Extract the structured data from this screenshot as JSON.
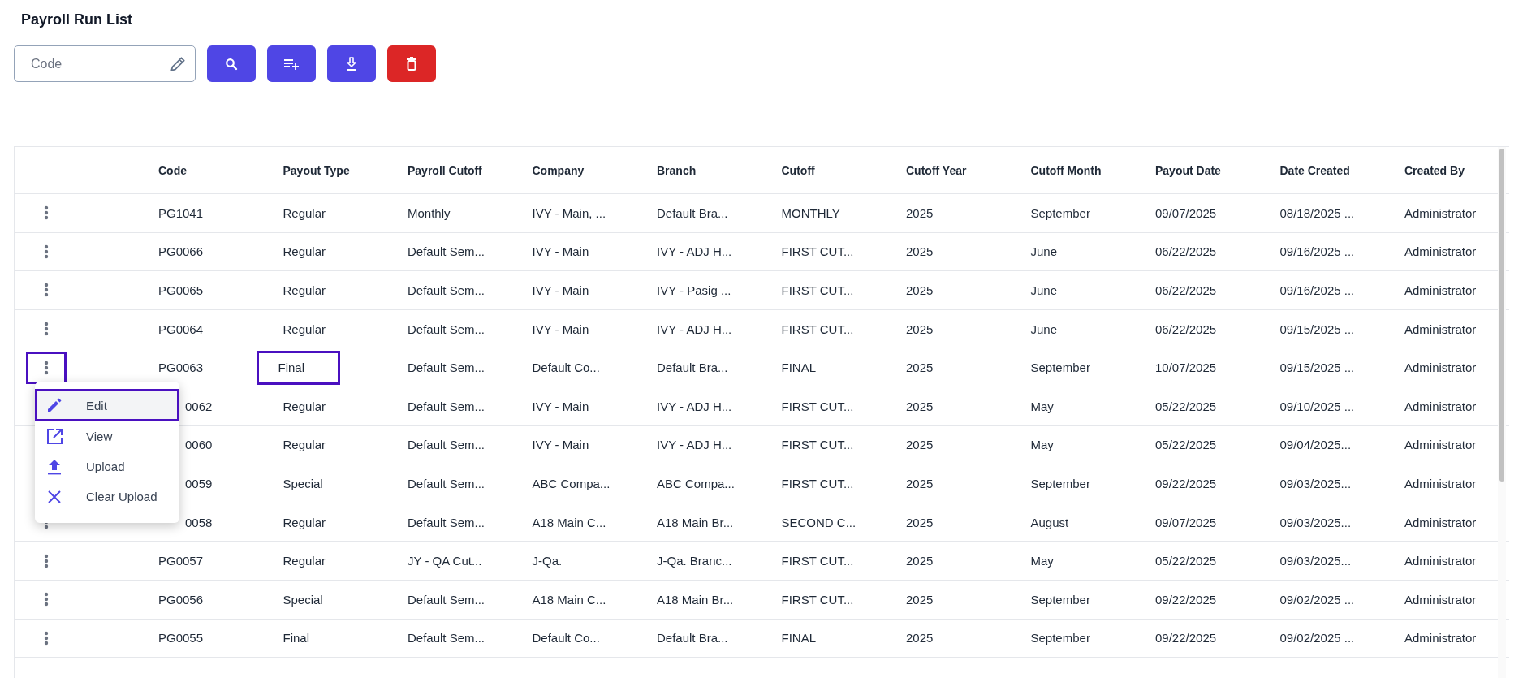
{
  "title": "Payroll Run List",
  "search": {
    "placeholder": "Code"
  },
  "toolbar_buttons": [
    {
      "kind": "search",
      "color": "#4f46e5"
    },
    {
      "kind": "add-list",
      "color": "#4f46e5"
    },
    {
      "kind": "download",
      "color": "#4f46e5"
    },
    {
      "kind": "delete",
      "color": "#dc2626"
    }
  ],
  "table": {
    "columns": [
      "Code",
      "Payout Type",
      "Payroll Cutoff",
      "Company",
      "Branch",
      "Cutoff",
      "Cutoff Year",
      "Cutoff Month",
      "Payout Date",
      "Date Created",
      "Created By"
    ],
    "rows": [
      {
        "kebab_marked": false,
        "type_marked": false,
        "cells": [
          "PG1041",
          "Regular",
          "Monthly",
          "IVY - Main, ...",
          "Default Bra...",
          "MONTHLY",
          "2025",
          "September",
          "09/07/2025",
          "08/18/2025 ...",
          "Administrator"
        ]
      },
      {
        "kebab_marked": false,
        "type_marked": false,
        "cells": [
          "PG0066",
          "Regular",
          "Default Sem...",
          "IVY - Main",
          "IVY - ADJ H...",
          "FIRST CUT...",
          "2025",
          "June",
          "06/22/2025",
          "09/16/2025 ...",
          "Administrator"
        ]
      },
      {
        "kebab_marked": false,
        "type_marked": false,
        "cells": [
          "PG0065",
          "Regular",
          "Default Sem...",
          "IVY - Main",
          "IVY - Pasig ...",
          "FIRST CUT...",
          "2025",
          "June",
          "06/22/2025",
          "09/16/2025 ...",
          "Administrator"
        ]
      },
      {
        "kebab_marked": false,
        "type_marked": false,
        "cells": [
          "PG0064",
          "Regular",
          "Default Sem...",
          "IVY - Main",
          "IVY - ADJ H...",
          "FIRST CUT...",
          "2025",
          "June",
          "06/22/2025",
          "09/15/2025 ...",
          "Administrator"
        ]
      },
      {
        "kebab_marked": true,
        "type_marked": true,
        "cells": [
          "PG0063",
          "Final",
          "Default Sem...",
          "Default Co...",
          "Default Bra...",
          "FINAL",
          "2025",
          "September",
          "10/07/2025",
          "09/15/2025 ...",
          "Administrator"
        ]
      },
      {
        "type_marked": false,
        "cells": [
          "0062",
          "Regular",
          "Default Sem...",
          "IVY - Main",
          "IVY - ADJ H...",
          "FIRST CUT...",
          "2025",
          "May",
          "05/22/2025",
          "09/10/2025 ...",
          "Administrator"
        ]
      },
      {
        "type_marked": false,
        "cells": [
          "0060",
          "Regular",
          "Default Sem...",
          "IVY - Main",
          "IVY - ADJ H...",
          "FIRST CUT...",
          "2025",
          "May",
          "05/22/2025",
          "09/04/2025...",
          "Administrator"
        ]
      },
      {
        "type_marked": false,
        "cells": [
          "0059",
          "Special",
          "Default Sem...",
          "ABC Compa...",
          "ABC Compa...",
          "FIRST CUT...",
          "2025",
          "September",
          "09/22/2025",
          "09/03/2025...",
          "Administrator"
        ]
      },
      {
        "kebab_marked": false,
        "type_marked": false,
        "cells": [
          "0058",
          "Regular",
          "Default Sem...",
          "A18 Main C...",
          "A18 Main Br...",
          "SECOND C...",
          "2025",
          "August",
          "09/07/2025",
          "09/03/2025...",
          "Administrator"
        ]
      },
      {
        "kebab_marked": false,
        "type_marked": false,
        "cells": [
          "PG0057",
          "Regular",
          "JY - QA Cut...",
          "J-Qa.",
          "J-Qa. Branc...",
          "FIRST CUT...",
          "2025",
          "May",
          "05/22/2025",
          "09/03/2025...",
          "Administrator"
        ]
      },
      {
        "kebab_marked": false,
        "type_marked": false,
        "cells": [
          "PG0056",
          "Special",
          "Default Sem...",
          "A18 Main C...",
          "A18 Main Br...",
          "FIRST CUT...",
          "2025",
          "September",
          "09/22/2025",
          "09/02/2025 ...",
          "Administrator"
        ]
      },
      {
        "kebab_marked": false,
        "type_marked": false,
        "cells": [
          "PG0055",
          "Final",
          "Default Sem...",
          "Default Co...",
          "Default Bra...",
          "FINAL",
          "2025",
          "September",
          "09/22/2025",
          "09/02/2025 ...",
          "Administrator"
        ]
      }
    ]
  },
  "row_menu": {
    "items": [
      {
        "kind": "edit",
        "label": "Edit",
        "selected": true
      },
      {
        "kind": "view",
        "label": "View",
        "selected": false
      },
      {
        "kind": "upload",
        "label": "Upload",
        "selected": false
      },
      {
        "kind": "clear",
        "label": "Clear Upload",
        "selected": false
      }
    ]
  }
}
